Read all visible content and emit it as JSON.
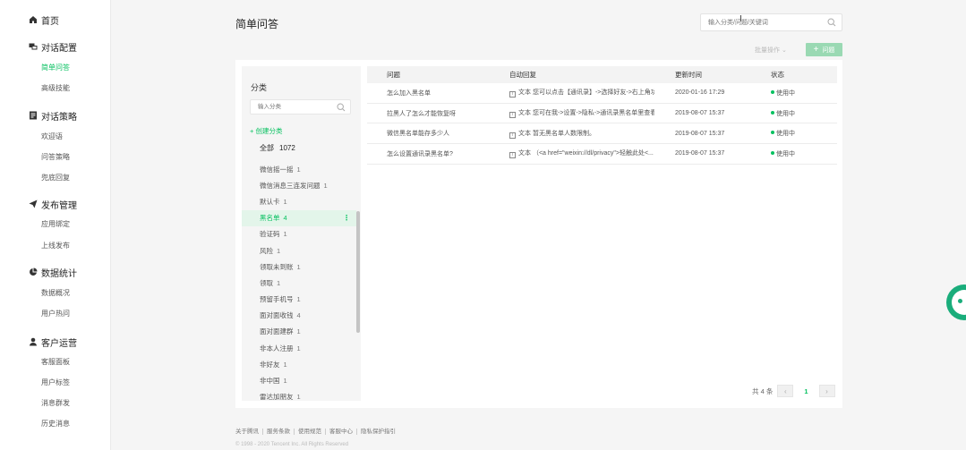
{
  "sidebar": {
    "groups": [
      {
        "label": "首页",
        "icon": "home-icon",
        "items": []
      },
      {
        "label": "对话配置",
        "icon": "chat-icon",
        "items": [
          "简单问答",
          "高级技能"
        ]
      },
      {
        "label": "对话策略",
        "icon": "strategy-icon",
        "items": [
          "欢迎语",
          "问答策略",
          "兜底回复"
        ]
      },
      {
        "label": "发布管理",
        "icon": "send-icon",
        "items": [
          "应用绑定",
          "上线发布"
        ]
      },
      {
        "label": "数据统计",
        "icon": "pie-chart-icon",
        "items": [
          "数据概况",
          "用户热问"
        ]
      },
      {
        "label": "客户运营",
        "icon": "user-icon",
        "items": [
          "客服面板",
          "用户标签",
          "消息群发",
          "历史消息"
        ]
      }
    ],
    "active_item": "简单问答",
    "colors": {
      "accent": "#07c160"
    }
  },
  "header": {
    "title": "简单问答",
    "search_placeholder": "输入分类/问题/关键词",
    "batch_label": "批量操作",
    "add_label": "问题"
  },
  "categories": {
    "title": "分类",
    "search_placeholder": "输入分类",
    "create_label": "创建分类",
    "all_label": "全部",
    "all_count": "1072",
    "items": [
      {
        "name": "微信摇一摇",
        "count": "1"
      },
      {
        "name": "微信消息三连发问题",
        "count": "1"
      },
      {
        "name": "默认卡",
        "count": "1"
      },
      {
        "name": "黑名单",
        "count": "4",
        "active": true
      },
      {
        "name": "验证码",
        "count": "1"
      },
      {
        "name": "风险",
        "count": "1"
      },
      {
        "name": "领取未到账",
        "count": "1"
      },
      {
        "name": "领取",
        "count": "1"
      },
      {
        "name": "预留手机号",
        "count": "1"
      },
      {
        "name": "面对面收钱",
        "count": "4"
      },
      {
        "name": "面对面建群",
        "count": "1"
      },
      {
        "name": "非本人注册",
        "count": "1"
      },
      {
        "name": "非好友",
        "count": "1"
      },
      {
        "name": "非中国",
        "count": "1"
      },
      {
        "name": "雷达加朋友",
        "count": "1"
      }
    ]
  },
  "table": {
    "columns": [
      "问题",
      "自动回复",
      "更新时间",
      "状态"
    ],
    "rows": [
      {
        "question": "怎么加入黑名单",
        "reply_type": "文本",
        "reply": "您可以点击【通讯录】->选择好友->右上角功...",
        "time": "2020-01-16 17:29",
        "status": "使用中"
      },
      {
        "question": "拉黑人了怎么才能恢复呀",
        "reply_type": "文本",
        "reply": "您可在我->设置->隐私->通讯录黑名单里查看。",
        "time": "2019-08-07 15:37",
        "status": "使用中"
      },
      {
        "question": "微信黑名单能存多少人",
        "reply_type": "文本",
        "reply": "暂无黑名单人数限制。",
        "time": "2019-08-07 15:37",
        "status": "使用中"
      },
      {
        "question": "怎么设置通讯录黑名单?",
        "reply_type": "文本",
        "reply": "（<a href=\"weixin://dl/privacy\">轻触此处<...",
        "time": "2019-08-07 15:37",
        "status": "使用中"
      }
    ]
  },
  "pagination": {
    "total": "共 4 条",
    "current": "1",
    "prev": "‹",
    "next": "›"
  },
  "footer": {
    "links": [
      "关于腾讯",
      "服务条款",
      "使用规范",
      "客服中心",
      "隐私保护指引"
    ],
    "copyright": "© 1998 - 2020 Tencent Inc. All Rights Reserved"
  }
}
